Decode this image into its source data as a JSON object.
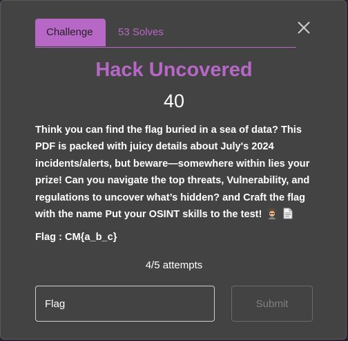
{
  "tabs": {
    "challenge": "Challenge",
    "solves": "53 Solves"
  },
  "challenge": {
    "name": "Hack Uncovered",
    "points": "40",
    "description": "Think you can find the flag buried in a sea of data? This PDF is packed with juicy details about July's 2024 incidents/alerts, but beware—somewhere within lies your prize! Can you navigate the top threats, Vulnerability, and regulations to uncover what’s hidden? and Craft the flag with the name Put your OSINT skills to the test!",
    "flag_format": "Flag : CM{a_b_c}",
    "attempts": "4/5 attempts"
  },
  "form": {
    "input_value": "",
    "input_placeholder": "Flag",
    "submit_label": "Submit"
  },
  "icons": {
    "close": "close-icon",
    "emoji_1": "detective-icon",
    "emoji_2": "document-icon"
  },
  "colors": {
    "accent": "#b768c6",
    "modal_bg": "#434343",
    "text": "#ffffff",
    "muted": "#808080"
  }
}
